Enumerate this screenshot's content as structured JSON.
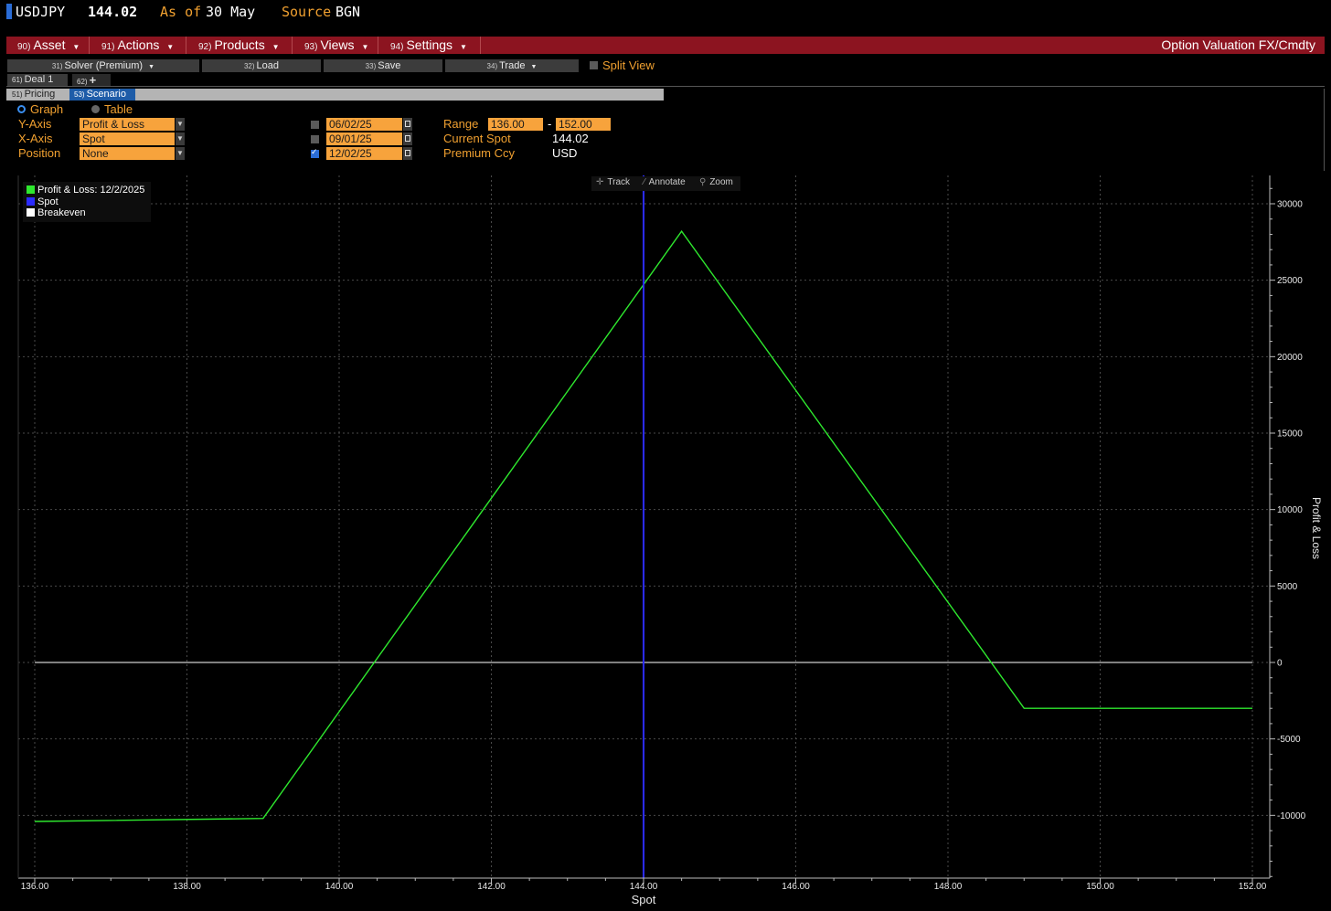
{
  "header": {
    "ticker": "USDJPY",
    "price": "144.02",
    "asof_label": "As of",
    "asof_date": "30 May",
    "source_label": "Source",
    "source_value": "BGN"
  },
  "menu": {
    "items": [
      {
        "num": "90)",
        "label": "Asset"
      },
      {
        "num": "91)",
        "label": "Actions"
      },
      {
        "num": "92)",
        "label": "Products"
      },
      {
        "num": "93)",
        "label": "Views"
      },
      {
        "num": "94)",
        "label": "Settings"
      }
    ],
    "title": "Option Valuation FX/Cmdty"
  },
  "toolbar": {
    "solver": {
      "num": "31)",
      "label": "Solver (Premium)"
    },
    "load": {
      "num": "32)",
      "label": "Load"
    },
    "save": {
      "num": "33)",
      "label": "Save"
    },
    "trade": {
      "num": "34)",
      "label": "Trade"
    },
    "split_view": "Split View"
  },
  "deal_tabs": [
    {
      "num": "61)",
      "label": "Deal 1"
    },
    {
      "num": "62)",
      "label": "+"
    }
  ],
  "view_tabs": [
    {
      "num": "51)",
      "label": "Pricing"
    },
    {
      "num": "53)",
      "label": "Scenario"
    }
  ],
  "controls": {
    "graph_label": "Graph",
    "table_label": "Table",
    "yaxis_label": "Y-Axis",
    "yaxis_value": "Profit & Loss",
    "xaxis_label": "X-Axis",
    "xaxis_value": "Spot",
    "position_label": "Position",
    "position_value": "None",
    "dates": [
      {
        "value": "06/02/25",
        "checked": false
      },
      {
        "value": "09/01/25",
        "checked": false
      },
      {
        "value": "12/02/25",
        "checked": true
      }
    ],
    "range_label": "Range",
    "range_min": "136.00",
    "range_sep": "-",
    "range_max": "152.00",
    "current_spot_label": "Current Spot",
    "current_spot_value": "144.02",
    "premium_ccy_label": "Premium Ccy",
    "premium_ccy_value": "USD"
  },
  "chart_tools": {
    "track": "Track",
    "annotate": "Annotate",
    "zoom": "Zoom"
  },
  "chart_data": {
    "type": "line",
    "xlabel": "Spot",
    "ylabel": "Profit & Loss",
    "xlim": [
      136,
      152
    ],
    "ylim": [
      -14000,
      32000
    ],
    "x_ticks": [
      "136.00",
      "138.00",
      "140.00",
      "142.00",
      "144.00",
      "146.00",
      "148.00",
      "150.00",
      "152.00"
    ],
    "x_tick_values": [
      136,
      138,
      140,
      142,
      144,
      146,
      148,
      150,
      152
    ],
    "y_ticks": [
      "30000",
      "25000",
      "20000",
      "15000",
      "10000",
      "5000",
      "0",
      "-5000",
      "-10000"
    ],
    "y_tick_values": [
      30000,
      25000,
      20000,
      15000,
      10000,
      5000,
      0,
      -5000,
      -10000
    ],
    "grid": true,
    "legend_position": "top-left",
    "series": [
      {
        "name": "Profit & Loss: 12/2/2025",
        "color": "#2ee82e",
        "x": [
          136.0,
          139.0,
          144.5,
          149.0,
          152.0
        ],
        "y": [
          -10400,
          -10200,
          28200,
          -3000,
          -3000
        ]
      }
    ],
    "spot": {
      "name": "Spot",
      "value": 144.0,
      "color": "#2b2bff"
    },
    "breakeven": {
      "name": "Breakeven",
      "value": 0,
      "color": "#ffffff"
    }
  }
}
